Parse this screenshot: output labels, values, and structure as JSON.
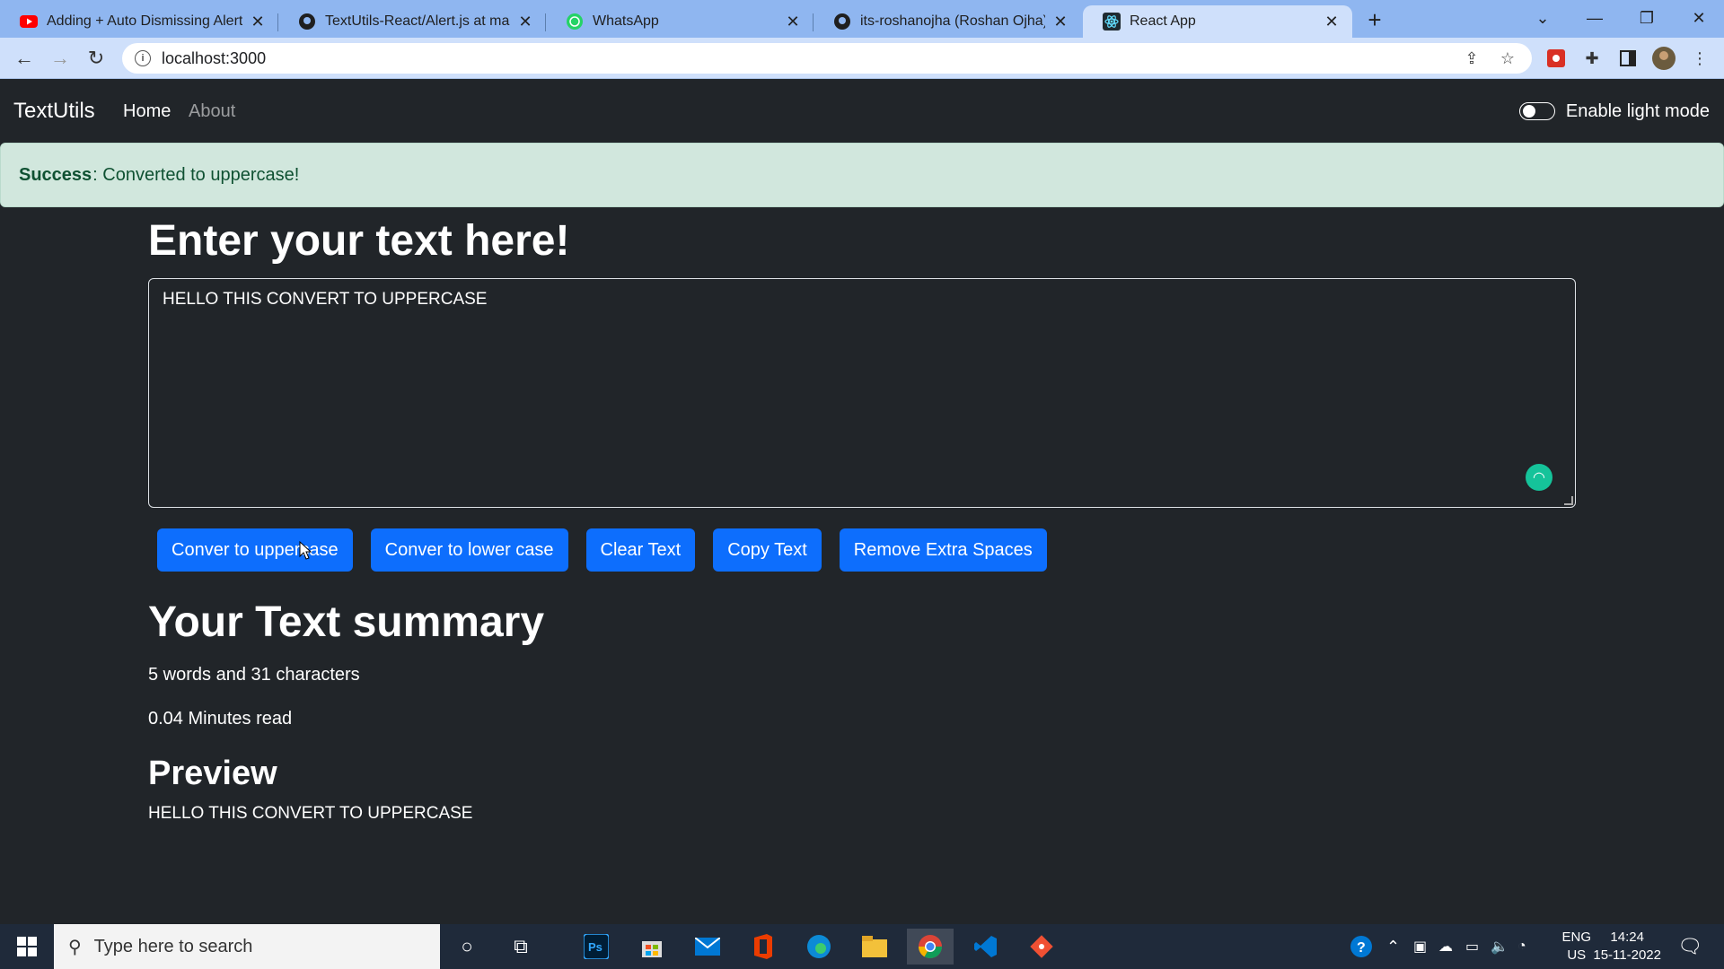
{
  "browser": {
    "tabs": [
      {
        "title": "Adding + Auto Dismissing Alert M",
        "icon": "youtube-icon"
      },
      {
        "title": "TextUtils-React/Alert.js at master",
        "icon": "github-icon"
      },
      {
        "title": "WhatsApp",
        "icon": "whatsapp-icon"
      },
      {
        "title": "its-roshanojha (Roshan Ojha)",
        "icon": "github-icon"
      },
      {
        "title": "React App",
        "icon": "react-icon",
        "active": true
      }
    ],
    "url": "localhost:3000"
  },
  "app": {
    "brand": "TextUtils",
    "nav": {
      "home": "Home",
      "about": "About"
    },
    "mode_toggle_label": "Enable light mode"
  },
  "alert": {
    "type": "Success",
    "message": ": Converted to uppercase!"
  },
  "form": {
    "heading": "Enter your text here!",
    "textarea_value": "HELLO THIS CONVERT TO UPPERCASE",
    "buttons": {
      "uppercase": "Conver to uppercase",
      "lowercase": "Conver to lower case",
      "clear": "Clear Text",
      "copy": "Copy Text",
      "remove_spaces": "Remove Extra Spaces"
    }
  },
  "summary": {
    "heading": "Your Text summary",
    "counts": "5 words and 31 characters",
    "read_time": "0.04 Minutes read",
    "preview_heading": "Preview",
    "preview_text": "HELLO THIS CONVERT TO UPPERCASE"
  },
  "taskbar": {
    "search_placeholder": "Type here to search",
    "lang_line1": "ENG",
    "lang_line2": "US",
    "time": "14:24",
    "date": "15-11-2022"
  },
  "colors": {
    "primary": "#0d6efd",
    "dark_bg": "#212529",
    "alert_bg": "#d1e7dd",
    "alert_text": "#0f5132"
  }
}
